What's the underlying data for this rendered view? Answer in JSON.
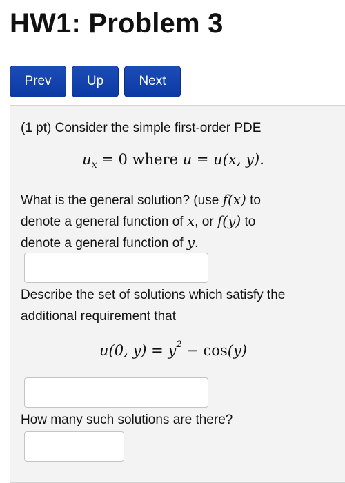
{
  "page_title": "HW1: Problem 3",
  "nav": {
    "prev_label": "Prev",
    "up_label": "Up",
    "next_label": "Next"
  },
  "problem": {
    "intro": "(1 pt) Consider the simple first-order PDE",
    "pde": {
      "lhs": "u",
      "lhs_sub": "x",
      "rhs_zero": "= 0",
      "where": "where",
      "def": "u = u(x, y)."
    },
    "q1": {
      "part1": "What is the general solution? (use ",
      "fx": "f(x)",
      "part2": " to",
      "part3": "denote a general function of ",
      "x": "x",
      "part4": ", or ",
      "fy": "f(y)",
      "part5": " to",
      "part6": "denote a general function of ",
      "y": "y",
      "part7": ".",
      "answer_value": ""
    },
    "q2": {
      "line1": "Describe the set of solutions which satisfy the",
      "line2": "additional requirement that",
      "cond_lhs": "u(0, y) = y",
      "cond_exp": "2",
      "cond_minus": " − ",
      "cond_cos": "cos",
      "cond_arg": "(y)",
      "answer_value": ""
    },
    "q3": {
      "text": "How many such solutions are there?",
      "answer_value": ""
    }
  }
}
